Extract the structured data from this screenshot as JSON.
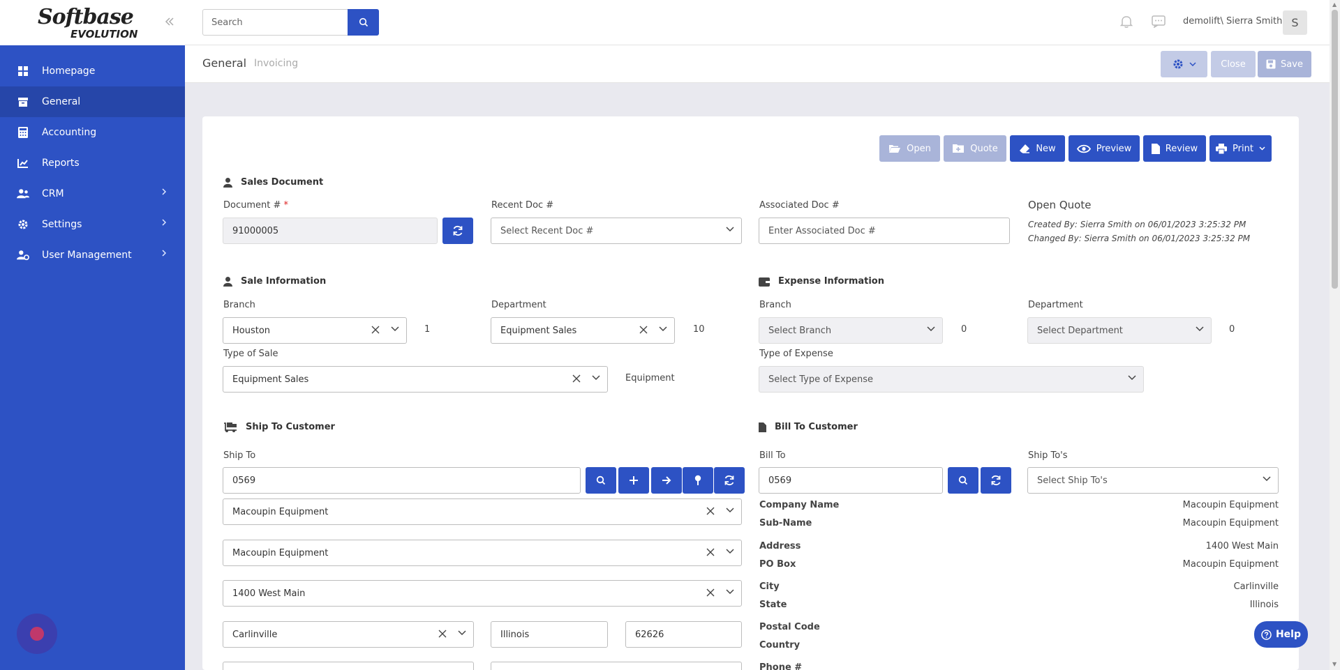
{
  "brand": {
    "logo_text": "Softbase",
    "logo_sub": "EVOLUTION"
  },
  "sidebar": {
    "items": [
      {
        "label": "Homepage",
        "icon": "homepage-grid-icon"
      },
      {
        "label": "General",
        "icon": "general-box-icon"
      },
      {
        "label": "Accounting",
        "icon": "accounting-calculator-icon"
      },
      {
        "label": "Reports",
        "icon": "reports-chart-icon"
      },
      {
        "label": "CRM",
        "icon": "crm-users-icon"
      },
      {
        "label": "Settings",
        "icon": "settings-gear-icon"
      },
      {
        "label": "User Management",
        "icon": "user-management-icon"
      }
    ],
    "active": "General"
  },
  "topbar": {
    "search_placeholder": "Search",
    "user": "demolift\\ Sierra Smith",
    "avatar_initial": "S"
  },
  "breadcrumb": {
    "primary": "General",
    "secondary": "Invoicing"
  },
  "header_actions": {
    "close": "Close",
    "save": "Save"
  },
  "toolbar": {
    "open": "Open",
    "quote": "Quote",
    "new": "New",
    "preview": "Preview",
    "review": "Review",
    "print": "Print"
  },
  "sales_document": {
    "title": "Sales Document",
    "doc_label": "Document #",
    "doc_value": "91000005",
    "recent_label": "Recent Doc #",
    "recent_placeholder": "Select Recent Doc #",
    "assoc_label": "Associated Doc #",
    "assoc_placeholder": "Enter Associated Doc #",
    "status": "Open Quote",
    "created": "Created By: Sierra Smith on 06/01/2023 3:25:32 PM",
    "changed": "Changed By: Sierra Smith on 06/01/2023 3:25:32 PM"
  },
  "sale_info": {
    "title": "Sale Information",
    "branch_label": "Branch",
    "branch_value": "Houston",
    "branch_code": "1",
    "dept_label": "Department",
    "dept_value": "Equipment Sales",
    "dept_code": "10",
    "type_label": "Type of Sale",
    "type_value": "Equipment Sales",
    "type_code": "Equipment"
  },
  "expense_info": {
    "title": "Expense Information",
    "branch_label": "Branch",
    "branch_placeholder": "Select Branch",
    "branch_code": "0",
    "dept_label": "Department",
    "dept_placeholder": "Select Department",
    "dept_code": "0",
    "type_label": "Type of Expense",
    "type_placeholder": "Select Type of Expense"
  },
  "ship_to": {
    "title": "Ship To Customer",
    "label": "Ship To",
    "value": "0569",
    "company": "Macoupin Equipment",
    "subname": "Macoupin Equipment",
    "address": "1400 West Main",
    "city": "Carlinville",
    "state": "Illinois",
    "zip": "62626"
  },
  "bill_to": {
    "title": "Bill To Customer",
    "label": "Bill To",
    "value": "0569",
    "shiptos_label": "Ship To's",
    "shiptos_placeholder": "Select Ship To's",
    "rows": [
      {
        "key": "Company Name",
        "value": "Macoupin Equipment"
      },
      {
        "key": "Sub-Name",
        "value": "Macoupin Equipment"
      },
      {
        "key": "Address",
        "value": "1400 West Main"
      },
      {
        "key": "PO Box",
        "value": "Macoupin Equipment"
      },
      {
        "key": "City",
        "value": "Carlinville"
      },
      {
        "key": "State",
        "value": "Illinois"
      },
      {
        "key": "Postal Code",
        "value": ""
      },
      {
        "key": "Country",
        "value": ""
      },
      {
        "key": "Phone #",
        "value": ""
      }
    ]
  },
  "help": {
    "label": "Help"
  },
  "colors": {
    "primary": "#2d52c4",
    "primary_dark": "#2646a9",
    "disabled": "#a9b4d9"
  }
}
